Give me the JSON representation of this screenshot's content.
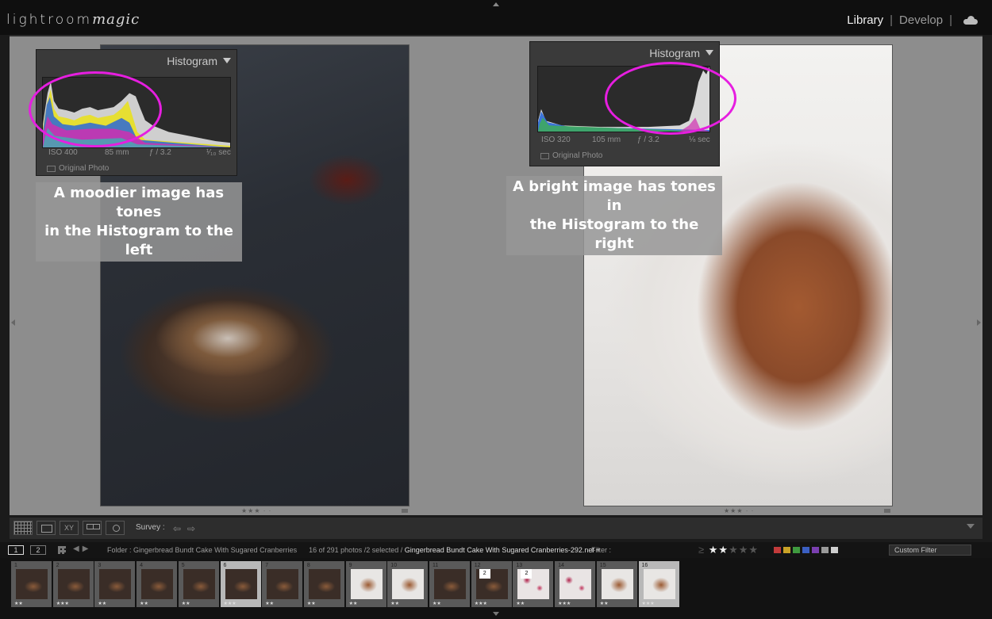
{
  "topbar": {
    "logo_main": "lightroom",
    "logo_script": "magic",
    "modules": [
      "Library",
      "Develop"
    ],
    "active_module": "Library",
    "separator": "|"
  },
  "left_histogram": {
    "title": "Histogram",
    "iso": "ISO 400",
    "focal": "85 mm",
    "aperture": "ƒ / 3.2",
    "shutter": "¹⁄₁₀ sec",
    "original_photo": "Original Photo"
  },
  "right_histogram": {
    "title": "Histogram",
    "iso": "ISO 320",
    "focal": "105 mm",
    "aperture": "ƒ / 3.2",
    "shutter": "⅛ sec",
    "original_photo": "Original Photo"
  },
  "annotations": {
    "left_line1": "A moodier image has tones",
    "left_line2": "in the Histogram to the left",
    "right_line1": "A bright image has tones in",
    "right_line2": "the Histogram to the right",
    "ellipse_color": "#e61ee0"
  },
  "ratings": {
    "left": "★★★ · ·",
    "right": "★★★ · ·"
  },
  "toolbar": {
    "compare_label": "XY",
    "survey_label": "Survey :"
  },
  "filmbar": {
    "screen1": "1",
    "screen2": "2",
    "folder_prefix": "Folder : Gingerbread Bundt Cake With Sugared Cranberries",
    "count": "16 of 291 photos /2 selected /",
    "filename": "Gingerbread Bundt Cake With Sugared Cranberries-292.nef",
    "filter_label": "Filter :",
    "stars_ge": "≥",
    "stars_on": "★★",
    "stars_off": "★★★",
    "color_labels": [
      "#c23b3b",
      "#c9a227",
      "#3f9a3f",
      "#3b5fc2",
      "#7a3fb0",
      "#9a9a9a",
      "#cfcfcf"
    ],
    "custom_filter": "Custom Filter"
  },
  "filmstrip": {
    "cells": [
      {
        "num": "1",
        "type": "dark",
        "stars": "★★"
      },
      {
        "num": "2",
        "type": "dark",
        "stars": "★★★"
      },
      {
        "num": "3",
        "type": "dark",
        "stars": "★★"
      },
      {
        "num": "4",
        "type": "dark",
        "stars": "★★"
      },
      {
        "num": "5",
        "type": "dark",
        "stars": "★★"
      },
      {
        "num": "6",
        "type": "dark",
        "stars": "★★★"
      },
      {
        "num": "7",
        "type": "dark",
        "stars": "★★"
      },
      {
        "num": "8",
        "type": "dark",
        "stars": "★★"
      },
      {
        "num": "9",
        "type": "light",
        "stars": "★★"
      },
      {
        "num": "10",
        "type": "light",
        "stars": "★★"
      },
      {
        "num": "11",
        "type": "dark",
        "stars": "★★"
      },
      {
        "num": "12",
        "type": "dark",
        "stars": "★★★"
      },
      {
        "num": "13",
        "type": "berry",
        "stars": "★★"
      },
      {
        "num": "14",
        "type": "berry",
        "stars": "★★★"
      },
      {
        "num": "15",
        "type": "light",
        "stars": "★★"
      },
      {
        "num": "16",
        "type": "light",
        "stars": "★★★"
      }
    ],
    "badge": "2"
  }
}
